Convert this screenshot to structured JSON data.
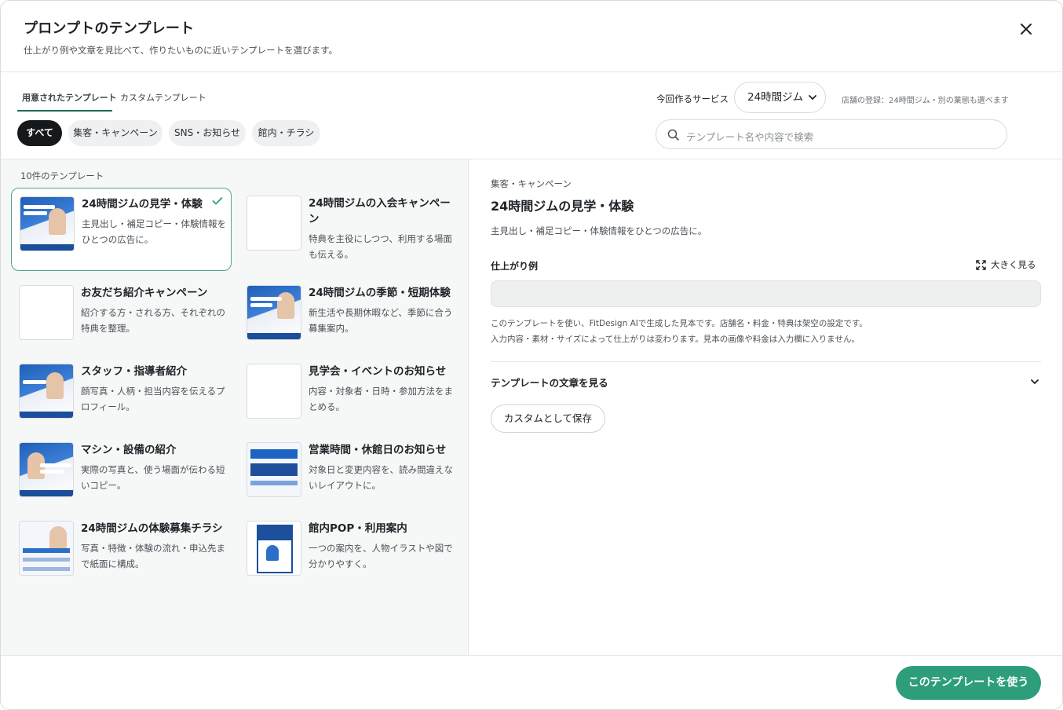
{
  "header": {
    "title": "プロンプトのテンプレート",
    "subtitle": "仕上がり例や文章を見比べて、作りたいものに近いテンプレートを選びます。"
  },
  "tabs": [
    {
      "label": "用意されたテンプレート",
      "active": true
    },
    {
      "label": "カスタムテンプレート",
      "active": false
    }
  ],
  "filters": [
    {
      "label": "すべて",
      "active": true
    },
    {
      "label": "集客・キャンペーン",
      "active": false
    },
    {
      "label": "SNS・お知らせ",
      "active": false
    },
    {
      "label": "館内・チラシ",
      "active": false
    }
  ],
  "service": {
    "label": "今回作るサービス",
    "selected": "24時間ジム",
    "note": "店舗の登録：24時間ジム・別の業態も選べます"
  },
  "search": {
    "placeholder": "テンプレート名や内容で検索"
  },
  "list": {
    "count_label": "10件のテンプレート",
    "items": [
      {
        "title": "24時間ジムの見学・体験",
        "desc": "主見出し・補足コピー・体験情報をひとつの広告に。",
        "selected": true
      },
      {
        "title": "24時間ジムの入会キャンペーン",
        "desc": "特典を主役にしつつ、利用する場面も伝える。",
        "selected": false
      },
      {
        "title": "お友だち紹介キャンペーン",
        "desc": "紹介する方・される方、それぞれの特典を整理。",
        "selected": false
      },
      {
        "title": "24時間ジムの季節・短期体験",
        "desc": "新生活や長期休暇など、季節に合う募集案内。",
        "selected": false
      },
      {
        "title": "スタッフ・指導者紹介",
        "desc": "顔写真・人柄・担当内容を伝えるプロフィール。",
        "selected": false
      },
      {
        "title": "見学会・イベントのお知らせ",
        "desc": "内容・対象者・日時・参加方法をまとめる。",
        "selected": false
      },
      {
        "title": "マシン・設備の紹介",
        "desc": "実際の写真と、使う場面が伝わる短いコピー。",
        "selected": false
      },
      {
        "title": "営業時間・休館日のお知らせ",
        "desc": "対象日と変更内容を、読み間違えないレイアウトに。",
        "selected": false
      },
      {
        "title": "24時間ジムの体験募集チラシ",
        "desc": "写真・特徴・体験の流れ・申込先まで紙面に構成。",
        "selected": false
      },
      {
        "title": "館内POP・利用案内",
        "desc": "一つの案内を、人物イラストや図で分かりやすく。",
        "selected": false
      }
    ]
  },
  "detail": {
    "category": "集客・キャンペーン",
    "title": "24時間ジムの見学・体験",
    "desc": "主見出し・補足コピー・体験情報をひとつの広告に。",
    "example_label": "仕上がり例",
    "expand_label": "大きく見る",
    "note1": "このテンプレートを使い、FitDesign AIで生成した見本です。店舗名・料金・特典は架空の設定です。",
    "note2": "入力内容・素材・サイズによって仕上がりは変わります。見本の画像や料金は入力欄に入りません。",
    "accordion_label": "テンプレートの文章を見る",
    "save_label": "カスタムとして保存"
  },
  "footer": {
    "use_label": "このテンプレートを使う"
  },
  "colors": {
    "accent": "#2e9d7c",
    "selected_border": "#4aa88c",
    "chip_active": "#16191c"
  }
}
